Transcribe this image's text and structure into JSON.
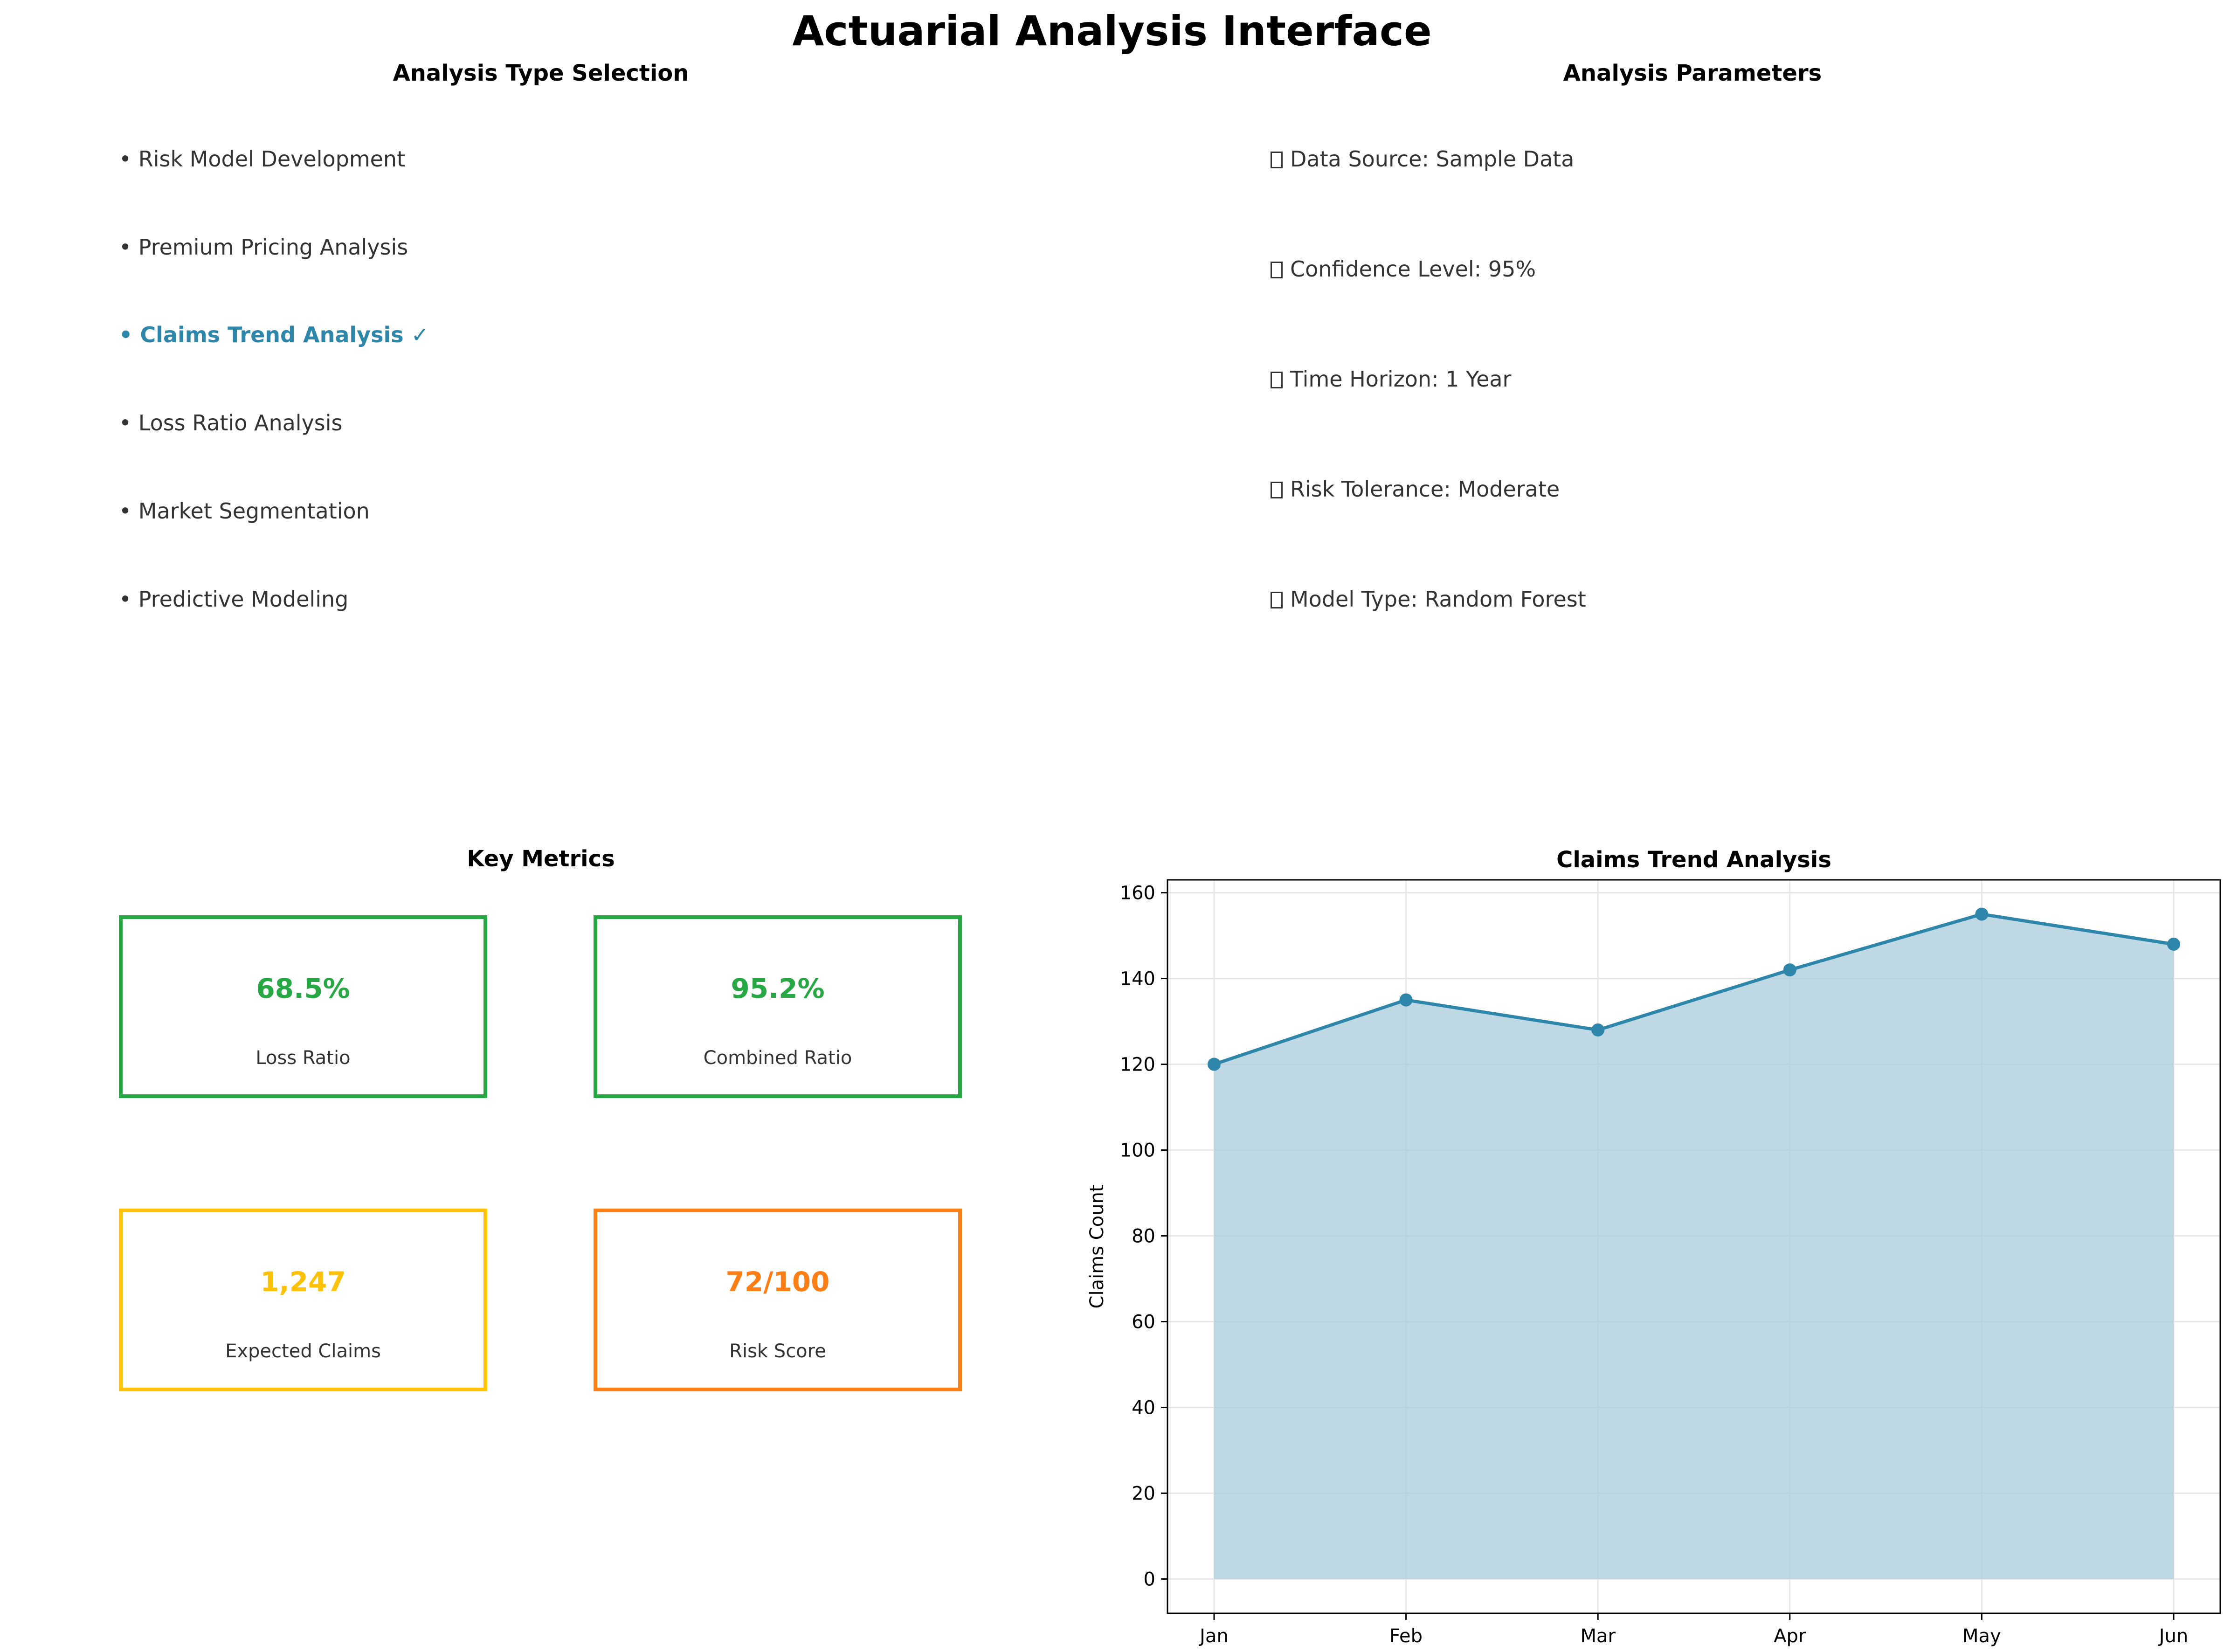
{
  "app": {
    "title": "Actuarial Analysis Interface"
  },
  "analysis_type": {
    "title": "Analysis Type Selection",
    "options": [
      {
        "label": "• Risk Model Development",
        "selected": false
      },
      {
        "label": "• Premium Pricing Analysis",
        "selected": false
      },
      {
        "label": "• Claims Trend Analysis ✓",
        "selected": true
      },
      {
        "label": "• Loss Ratio Analysis",
        "selected": false
      },
      {
        "label": "• Market Segmentation",
        "selected": false
      },
      {
        "label": "• Predictive Modeling",
        "selected": false
      }
    ]
  },
  "parameters": {
    "title": "Analysis Parameters",
    "items": [
      {
        "label": "Data Source: Sample Data"
      },
      {
        "label": "Confidence Level: 95%"
      },
      {
        "label": "Time Horizon: 1 Year"
      },
      {
        "label": "Risk Tolerance: Moderate"
      },
      {
        "label": "Model Type: Random Forest"
      }
    ]
  },
  "key_metrics": {
    "title": "Key Metrics",
    "cards": [
      {
        "value": "68.5%",
        "label": "Loss Ratio",
        "color": "#28a745"
      },
      {
        "value": "95.2%",
        "label": "Combined Ratio",
        "color": "#28a745"
      },
      {
        "value": "1,247",
        "label": "Expected Claims",
        "color": "#ffc107"
      },
      {
        "value": "72/100",
        "label": "Risk Score",
        "color": "#fd7e14"
      }
    ]
  },
  "chart_data": {
    "type": "area",
    "title": "Claims Trend Analysis",
    "xlabel": "",
    "ylabel": "Claims Count",
    "categories": [
      "Jan",
      "Feb",
      "Mar",
      "Apr",
      "May",
      "Jun"
    ],
    "values": [
      120,
      135,
      128,
      142,
      155,
      148
    ],
    "ylim": [
      -8,
      163
    ],
    "yticks": [
      0,
      20,
      40,
      60,
      80,
      100,
      120,
      140,
      160
    ],
    "grid": true,
    "line_color": "#2e86ab",
    "fill_color": "#a3c9d9"
  }
}
